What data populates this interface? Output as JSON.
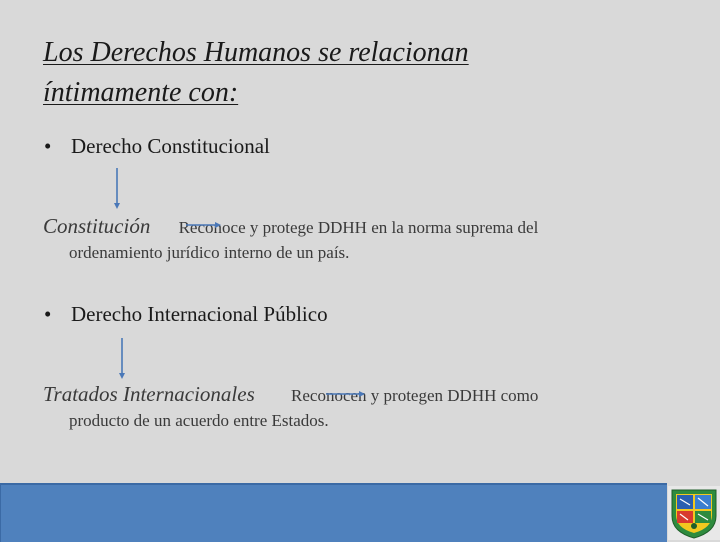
{
  "slide": {
    "title_line1": "Los Derechos Humanos se relacionan",
    "title_line2": "íntimamente con:",
    "bullet_char": "•",
    "section1": {
      "bullet": "Derecho Constitucional",
      "term": "Constitución",
      "desc_part1": "Reconoce y protege DDHH en la norma suprema del",
      "desc_part2": "ordenamiento jurídico interno de un país."
    },
    "section2": {
      "bullet": "Derecho Internacional Público",
      "term": "Tratados Internacionales",
      "desc_part1": "Reconocen y protegen DDHH como",
      "desc_part2": "producto de un acuerdo entre Estados."
    }
  },
  "colors": {
    "background": "#d9d9d9",
    "footer": "#4f81bd",
    "arrow": "#4a78b8"
  },
  "icons": {
    "arrow": "arrow-down-icon",
    "connector": "arrow-right-icon",
    "logo": "university-crest-logo"
  }
}
